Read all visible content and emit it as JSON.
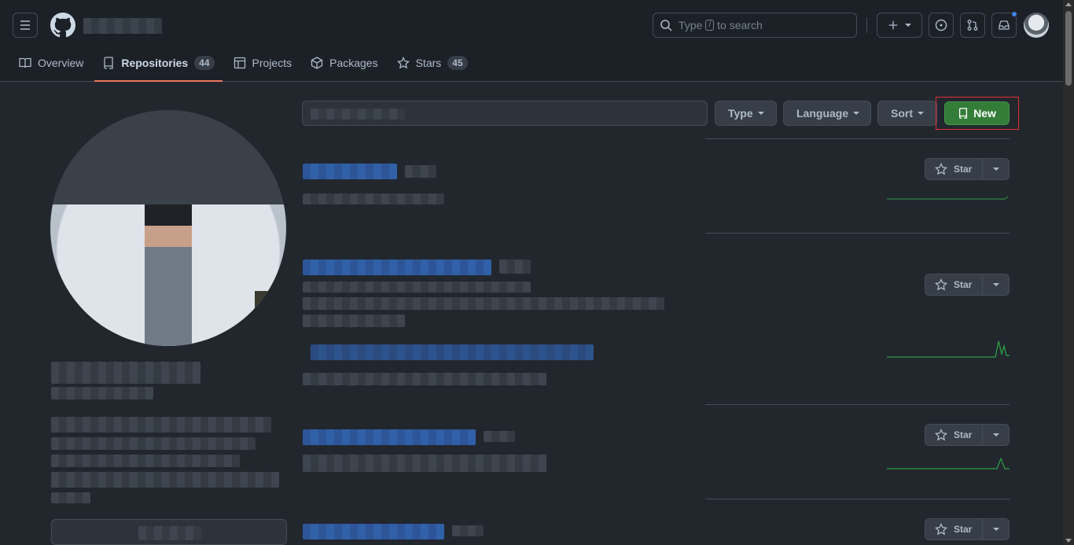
{
  "header": {
    "search_prefix": "Type",
    "search_key": "/",
    "search_suffix": "to search"
  },
  "tabs": [
    {
      "label": "Overview",
      "icon": "book-icon"
    },
    {
      "label": "Repositories",
      "icon": "repo-icon",
      "count": "44"
    },
    {
      "label": "Projects",
      "icon": "table-icon"
    },
    {
      "label": "Packages",
      "icon": "package-icon"
    },
    {
      "label": "Stars",
      "icon": "star-icon",
      "count": "45"
    }
  ],
  "filters": {
    "type_label": "Type",
    "language_label": "Language",
    "sort_label": "Sort",
    "new_label": "New"
  },
  "repos": [
    {
      "star_label": "Star"
    },
    {
      "star_label": "Star"
    },
    {
      "star_label": "Star"
    },
    {
      "star_label": "Star"
    }
  ],
  "colors": {
    "accent_tab": "#ec775c",
    "new_button": "#347d39",
    "link_blue": "#3266b5",
    "sparkline": "#2ea043"
  }
}
